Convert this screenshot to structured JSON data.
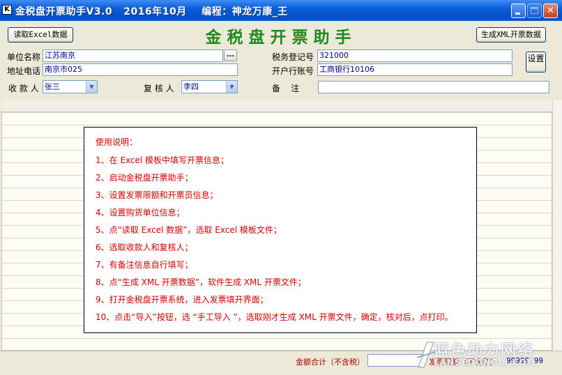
{
  "window": {
    "title": "金税盘开票助手V3.0   2016年10月    编程：神龙万康_王",
    "app_icon_letter": "K"
  },
  "toolbar": {
    "read_excel_label": "读取Excel数据",
    "generate_xml_label": "生成XML开票数据",
    "settings_label": "设置"
  },
  "headline": "金税盘开票助手",
  "form": {
    "unit_name_label": "单位名称",
    "unit_name_value": "江苏南京",
    "address_label": "地址电话",
    "address_value": "南京市025",
    "tax_id_label": "税务登记号",
    "tax_id_value": "321000",
    "bank_label": "开户行账号",
    "bank_value": "工商银行10106",
    "payee_label": "收 款 人",
    "payee_value": "张三",
    "reviewer_label": "复 核 人",
    "reviewer_value": "李四",
    "remark_label": "备    注",
    "remark_value": "",
    "browse_label": "..."
  },
  "instructions": {
    "title": "使用说明：",
    "lines": [
      "1、在 Excel 模板中填写开票信息；",
      "2、启动金税盘开票助手；",
      "3、设置发票限额和开票员信息；",
      "4、设置购货单位信息；",
      "5、点“读取 Excel 数据”，选取 Excel 模板文件；",
      "6、选取收款人和复核人；",
      "7、有备注信息自行填写；",
      "8、点“生成 XML 开票数据”，软件生成 XML 开票文件；",
      "9、打开金税盘开票系统，进入发票填开界面；",
      "10、点击“导入”按钮，选 “手工导入 ”，选取刚才生成 XML 开票文件，确定，核对后，点打印。"
    ]
  },
  "status": {
    "sum_label": "金额合计（不含税）",
    "sum_value": "",
    "limit_label": "发票限额（不含税）",
    "limit_value": "99999.99"
  },
  "watermark": {
    "text_cn": "蓝色动力网络",
    "text_en": "LANSEDONGLI.COM"
  },
  "colors": {
    "headline": "#1c8a1c",
    "instructions_text": "#d40000",
    "field_text": "#00008b",
    "titlebar": "#0a5fd8"
  }
}
